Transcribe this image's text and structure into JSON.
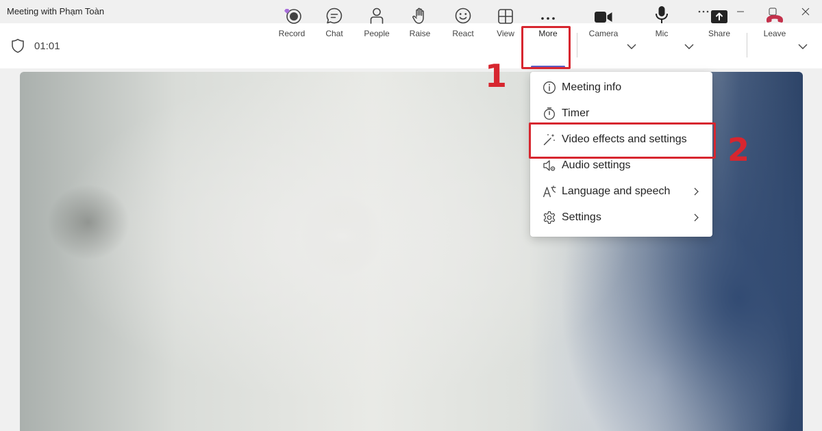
{
  "window": {
    "title": "Meeting with Phạm Toàn"
  },
  "toolbar": {
    "elapsed": "01:01",
    "buttons": [
      {
        "id": "record",
        "label": "Record",
        "icon": "record-icon"
      },
      {
        "id": "chat",
        "label": "Chat",
        "icon": "chat-icon"
      },
      {
        "id": "people",
        "label": "People",
        "icon": "people-icon"
      },
      {
        "id": "raise",
        "label": "Raise",
        "icon": "hand-icon"
      },
      {
        "id": "react",
        "label": "React",
        "icon": "smiley-icon"
      },
      {
        "id": "view",
        "label": "View",
        "icon": "grid-icon"
      },
      {
        "id": "more",
        "label": "More",
        "icon": "ellipsis-icon"
      },
      {
        "id": "camera",
        "label": "Camera",
        "icon": "camera-icon"
      },
      {
        "id": "mic",
        "label": "Mic",
        "icon": "mic-icon"
      },
      {
        "id": "share",
        "label": "Share",
        "icon": "share-icon"
      },
      {
        "id": "leave",
        "label": "Leave",
        "icon": "phone-hangup-icon"
      }
    ]
  },
  "more_menu": {
    "items": [
      {
        "label": "Meeting info",
        "icon": "info-icon",
        "submenu": false
      },
      {
        "label": "Timer",
        "icon": "stopwatch-icon",
        "submenu": false
      },
      {
        "label": "Video effects and settings",
        "icon": "magic-wand-icon",
        "submenu": false
      },
      {
        "label": "Audio settings",
        "icon": "speaker-settings-icon",
        "submenu": false
      },
      {
        "label": "Language and speech",
        "icon": "language-icon",
        "submenu": true
      },
      {
        "label": "Settings",
        "icon": "gear-icon",
        "submenu": true
      }
    ]
  },
  "annotations": {
    "step1": "1",
    "step2": "2"
  },
  "colors": {
    "accent": "#5b5fc7",
    "leave_red": "#c4314b",
    "annotation_red": "#d7262f"
  }
}
